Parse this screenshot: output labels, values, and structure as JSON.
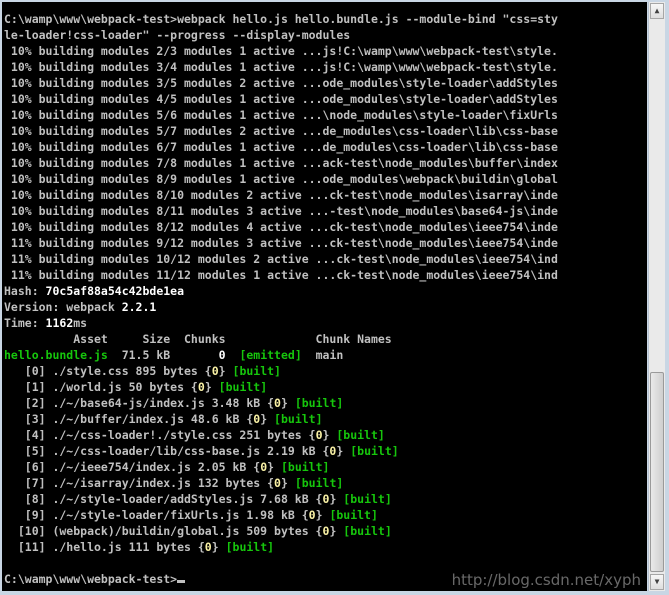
{
  "lines": [
    [
      {
        "t": "C:\\wamp\\www\\webpack-test>webpack hello.js hello.bundle.js --module-bind \"css=sty"
      }
    ],
    [
      {
        "t": "le-loader!css-loader\" --progress --display-modules"
      }
    ],
    [
      {
        "t": " 10% building modules 2/3 modules 1 active ...js!C:\\wamp\\www\\webpack-test\\style."
      }
    ],
    [
      {
        "t": " 10% building modules 3/4 modules 1 active ...js!C:\\wamp\\www\\webpack-test\\style."
      }
    ],
    [
      {
        "t": " 10% building modules 3/5 modules 2 active ...ode_modules\\style-loader\\addStyles"
      }
    ],
    [
      {
        "t": " 10% building modules 4/5 modules 1 active ...ode_modules\\style-loader\\addStyles"
      }
    ],
    [
      {
        "t": " 10% building modules 5/6 modules 1 active ...\\node_modules\\style-loader\\fixUrls"
      }
    ],
    [
      {
        "t": " 10% building modules 5/7 modules 2 active ...de_modules\\css-loader\\lib\\css-base"
      }
    ],
    [
      {
        "t": " 10% building modules 6/7 modules 1 active ...de_modules\\css-loader\\lib\\css-base"
      }
    ],
    [
      {
        "t": " 10% building modules 7/8 modules 1 active ...ack-test\\node_modules\\buffer\\index"
      }
    ],
    [
      {
        "t": " 10% building modules 8/9 modules 1 active ...ode_modules\\webpack\\buildin\\global"
      }
    ],
    [
      {
        "t": " 10% building modules 8/10 modules 2 active ...ck-test\\node_modules\\isarray\\inde"
      }
    ],
    [
      {
        "t": " 10% building modules 8/11 modules 3 active ...-test\\node_modules\\base64-js\\inde"
      }
    ],
    [
      {
        "t": " 10% building modules 8/12 modules 4 active ...ck-test\\node_modules\\ieee754\\inde"
      }
    ],
    [
      {
        "t": " 11% building modules 9/12 modules 3 active ...ck-test\\node_modules\\ieee754\\inde"
      }
    ],
    [
      {
        "t": " 11% building modules 10/12 modules 2 active ...ck-test\\node_modules\\ieee754\\ind"
      }
    ],
    [
      {
        "t": " 11% building modules 11/12 modules 1 active ...ck-test\\node_modules\\ieee754\\ind"
      }
    ],
    [
      {
        "t": "Hash: "
      },
      {
        "t": "70c5af88a54c42bde1ea",
        "c": "white"
      }
    ],
    [
      {
        "t": "Version: webpack "
      },
      {
        "t": "2.2.1",
        "c": "white"
      }
    ],
    [
      {
        "t": "Time: "
      },
      {
        "t": "1162",
        "c": "white"
      },
      {
        "t": "ms"
      }
    ],
    [
      {
        "t": "          Asset     Size  Chunks             Chunk Names"
      }
    ],
    [
      {
        "t": "hello.bundle.js",
        "c": "green"
      },
      {
        "t": "  71.5 kB       "
      },
      {
        "t": "0",
        "c": "white"
      },
      {
        "t": "  "
      },
      {
        "t": "[emitted]",
        "c": "green"
      },
      {
        "t": "  main"
      }
    ],
    [
      {
        "t": "   [0] ./style.css 895 bytes {"
      },
      {
        "t": "0",
        "c": "yellow"
      },
      {
        "t": "} "
      },
      {
        "t": "[built]",
        "c": "green"
      }
    ],
    [
      {
        "t": "   [1] ./world.js 50 bytes {"
      },
      {
        "t": "0",
        "c": "yellow"
      },
      {
        "t": "} "
      },
      {
        "t": "[built]",
        "c": "green"
      }
    ],
    [
      {
        "t": "   [2] ./~/base64-js/index.js 3.48 kB {"
      },
      {
        "t": "0",
        "c": "yellow"
      },
      {
        "t": "} "
      },
      {
        "t": "[built]",
        "c": "green"
      }
    ],
    [
      {
        "t": "   [3] ./~/buffer/index.js 48.6 kB {"
      },
      {
        "t": "0",
        "c": "yellow"
      },
      {
        "t": "} "
      },
      {
        "t": "[built]",
        "c": "green"
      }
    ],
    [
      {
        "t": "   [4] ./~/css-loader!./style.css 251 bytes {"
      },
      {
        "t": "0",
        "c": "yellow"
      },
      {
        "t": "} "
      },
      {
        "t": "[built]",
        "c": "green"
      }
    ],
    [
      {
        "t": "   [5] ./~/css-loader/lib/css-base.js 2.19 kB {"
      },
      {
        "t": "0",
        "c": "yellow"
      },
      {
        "t": "} "
      },
      {
        "t": "[built]",
        "c": "green"
      }
    ],
    [
      {
        "t": "   [6] ./~/ieee754/index.js 2.05 kB {"
      },
      {
        "t": "0",
        "c": "yellow"
      },
      {
        "t": "} "
      },
      {
        "t": "[built]",
        "c": "green"
      }
    ],
    [
      {
        "t": "   [7] ./~/isarray/index.js 132 bytes {"
      },
      {
        "t": "0",
        "c": "yellow"
      },
      {
        "t": "} "
      },
      {
        "t": "[built]",
        "c": "green"
      }
    ],
    [
      {
        "t": "   [8] ./~/style-loader/addStyles.js 7.68 kB {"
      },
      {
        "t": "0",
        "c": "yellow"
      },
      {
        "t": "} "
      },
      {
        "t": "[built]",
        "c": "green"
      }
    ],
    [
      {
        "t": "   [9] ./~/style-loader/fixUrls.js 1.98 kB {"
      },
      {
        "t": "0",
        "c": "yellow"
      },
      {
        "t": "} "
      },
      {
        "t": "[built]",
        "c": "green"
      }
    ],
    [
      {
        "t": "  [10] (webpack)/buildin/global.js 509 bytes {"
      },
      {
        "t": "0",
        "c": "yellow"
      },
      {
        "t": "} "
      },
      {
        "t": "[built]",
        "c": "green"
      }
    ],
    [
      {
        "t": "  [11] ./hello.js 111 bytes {"
      },
      {
        "t": "0",
        "c": "yellow"
      },
      {
        "t": "} "
      },
      {
        "t": "[built]",
        "c": "green"
      }
    ],
    [
      {
        "t": ""
      }
    ],
    [
      {
        "t": "C:\\wamp\\www\\webpack-test>"
      },
      {
        "cursor": true
      }
    ]
  ],
  "watermark": "http://blog.csdn.net/xyph"
}
